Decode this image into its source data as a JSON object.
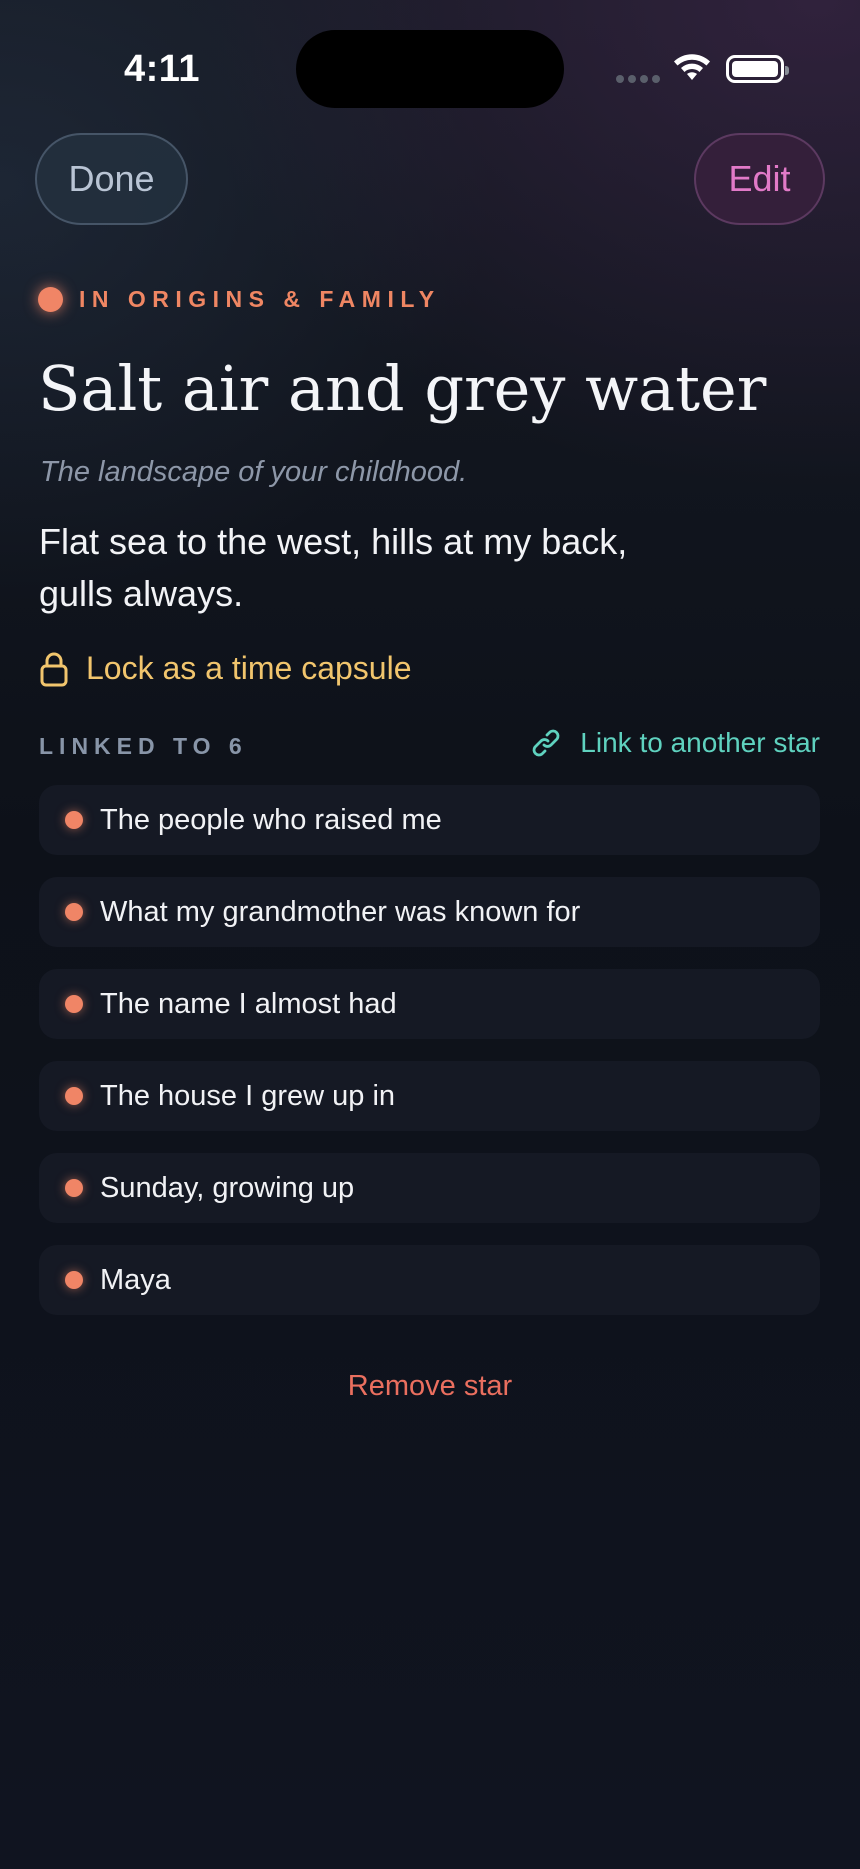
{
  "status_bar": {
    "time": "4:11"
  },
  "nav": {
    "done_label": "Done",
    "edit_label": "Edit"
  },
  "star": {
    "category": "IN ORIGINS & FAMILY",
    "title": "Salt air and grey water",
    "prompt": "The landscape of your childhood.",
    "body_line_1": "Flat sea to the west, hills at my back,",
    "body_line_2": "gulls always."
  },
  "lock": {
    "label": "Lock as a time capsule"
  },
  "linked": {
    "header": "LINKED TO 6",
    "link_button_label": "Link to another star",
    "items": [
      {
        "label": "The people who raised me"
      },
      {
        "label": "What my grandmother was known for"
      },
      {
        "label": "The name I almost had"
      },
      {
        "label": "The house I grew up in"
      },
      {
        "label": "Sunday, growing up"
      },
      {
        "label": "Maya"
      }
    ]
  },
  "remove_label": "Remove star",
  "colors": {
    "category_accent": "#ef8663",
    "lock_accent": "#f1c56d",
    "link_accent": "#5fd2bf",
    "edit_accent": "#e27ac8",
    "danger": "#ea6f5f"
  },
  "icons": {
    "lock": "lock-icon",
    "link": "link-icon",
    "wifi": "wifi-icon",
    "battery": "battery-icon"
  }
}
